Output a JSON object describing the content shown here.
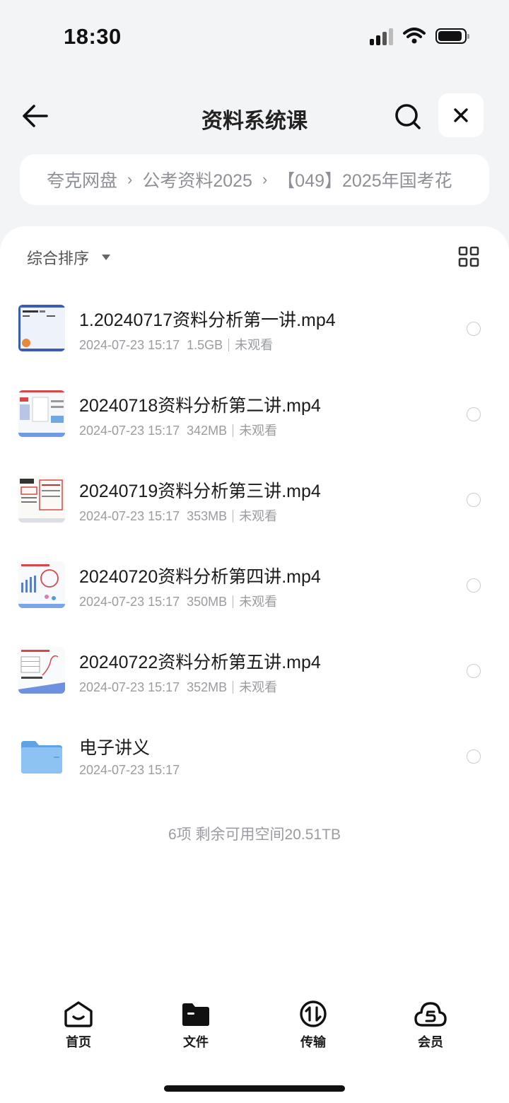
{
  "status_bar": {
    "time": "18:30"
  },
  "header": {
    "title": "资料系统课"
  },
  "breadcrumb": [
    {
      "label": "夸克网盘"
    },
    {
      "label": "公考资料2025"
    },
    {
      "label": "【049】2025年国考花"
    }
  ],
  "toolbar": {
    "sort_label": "综合排序"
  },
  "files": [
    {
      "name": "1.20240717资料分析第一讲.mp4",
      "date": "2024-07-23 15:17",
      "size": "1.5GB",
      "status": "未观看",
      "icon": "video-thumbnail"
    },
    {
      "name": "20240718资料分析第二讲.mp4",
      "date": "2024-07-23 15:17",
      "size": "342MB",
      "status": "未观看",
      "icon": "video-thumbnail"
    },
    {
      "name": "20240719资料分析第三讲.mp4",
      "date": "2024-07-23 15:17",
      "size": "353MB",
      "status": "未观看",
      "icon": "video-thumbnail"
    },
    {
      "name": "20240720资料分析第四讲.mp4",
      "date": "2024-07-23 15:17",
      "size": "350MB",
      "status": "未观看",
      "icon": "video-thumbnail"
    },
    {
      "name": "20240722资料分析第五讲.mp4",
      "date": "2024-07-23 15:17",
      "size": "352MB",
      "status": "未观看",
      "icon": "video-thumbnail"
    },
    {
      "name": "电子讲义",
      "date": "2024-07-23 15:17",
      "icon": "folder-icon"
    }
  ],
  "footer": {
    "summary": "6项 剩余可用空间20.51TB"
  },
  "tabs": [
    {
      "label": "首页",
      "icon": "home-icon"
    },
    {
      "label": "文件",
      "icon": "folder-icon"
    },
    {
      "label": "传输",
      "icon": "transfer-icon"
    },
    {
      "label": "会员",
      "icon": "vip-icon"
    }
  ],
  "colors": {
    "background": "#f3f4f6",
    "panel": "#ffffff",
    "folder_blue": "#7ab8f0",
    "text_secondary": "#9a9ca1"
  }
}
